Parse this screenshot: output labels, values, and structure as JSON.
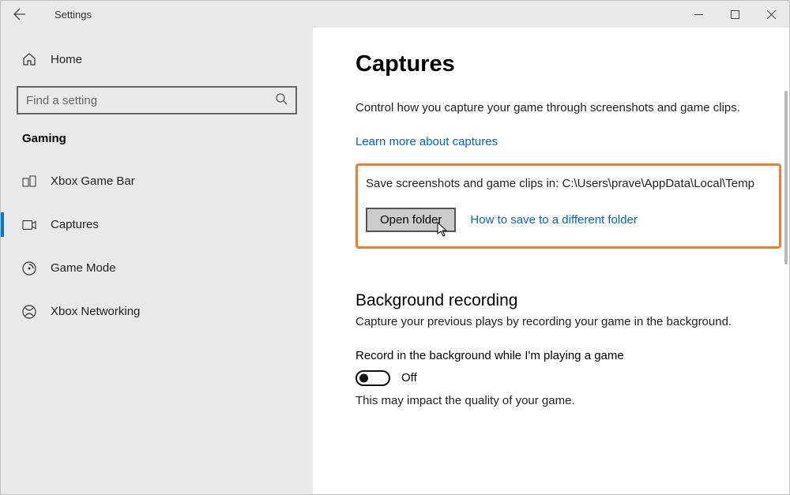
{
  "window": {
    "title": "Settings"
  },
  "sidebar": {
    "home_label": "Home",
    "search_placeholder": "Find a setting",
    "category": "Gaming",
    "items": [
      {
        "label": "Xbox Game Bar"
      },
      {
        "label": "Captures"
      },
      {
        "label": "Game Mode"
      },
      {
        "label": "Xbox Networking"
      }
    ]
  },
  "content": {
    "title": "Captures",
    "description": "Control how you capture your game through screenshots and game clips.",
    "learn_link": "Learn more about captures",
    "save_path_text": "Save screenshots and game clips in: C:\\Users\\prave\\AppData\\Local\\Temp",
    "open_folder_label": "Open folder",
    "diff_folder_link": "How to save to a different folder",
    "bg_title": "Background recording",
    "bg_desc": "Capture your previous plays by recording your game in the background.",
    "toggle_label": "Record in the background while I'm playing a game",
    "toggle_state": "Off",
    "impact_text": "This may impact the quality of your game."
  }
}
